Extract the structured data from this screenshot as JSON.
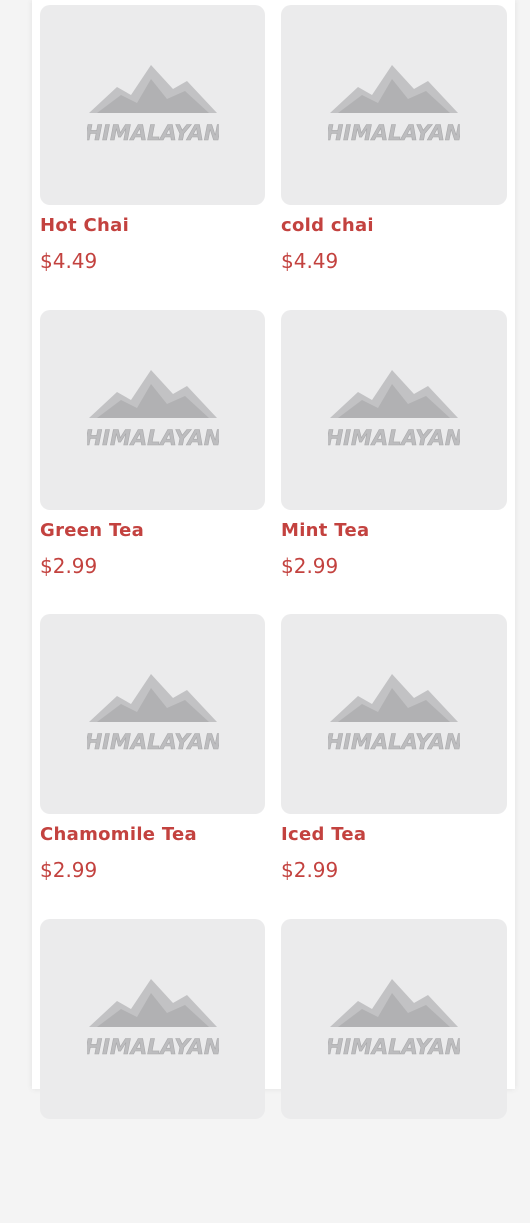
{
  "menu": {
    "logo_text": "HIMALAYAN",
    "items": [
      {
        "name": "Hot Chai",
        "price": "$4.49"
      },
      {
        "name": "cold chai",
        "price": "$4.49"
      },
      {
        "name": "Green Tea",
        "price": "$2.99"
      },
      {
        "name": "Mint Tea",
        "price": "$2.99"
      },
      {
        "name": "Chamomile Tea",
        "price": "$2.99"
      },
      {
        "name": "Iced Tea",
        "price": "$2.99"
      },
      {
        "name": "",
        "price": ""
      },
      {
        "name": "",
        "price": ""
      }
    ]
  },
  "colors": {
    "accent": "#c3423f",
    "placeholder_bg": "#ebebec"
  }
}
